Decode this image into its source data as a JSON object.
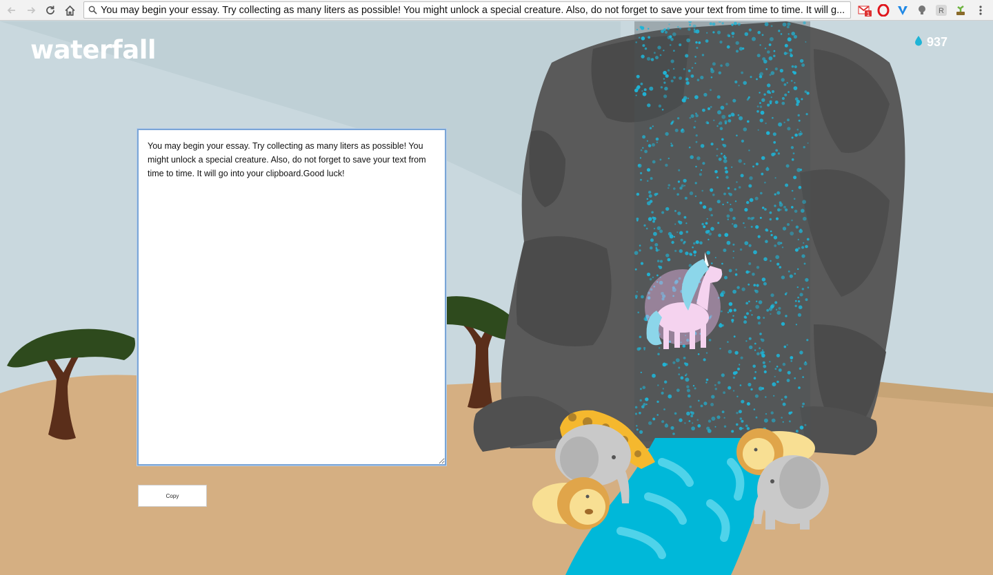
{
  "browser": {
    "address_text": "You may begin your essay. Try collecting as many liters as possible! You might unlock a special creature. Also, do not forget to save your text from time to time. It will g...",
    "extension_badge": "1"
  },
  "app": {
    "logo": "waterfall",
    "liters": "937"
  },
  "editor": {
    "text": "You may begin your essay. Try collecting as many liters as possible! You might unlock a special creature. Also, do not forget to save your text from time to time. It will go into your clipboard.Good luck!"
  },
  "copy_button": {
    "label": "Copy"
  },
  "colors": {
    "sky": "#c9d8de",
    "ground": "#d5af82",
    "rock": "#555555",
    "water": "#00b8d9",
    "accent": "#1fb4d6"
  },
  "icons": [
    "back-icon",
    "forward-icon",
    "reload-icon",
    "home-icon",
    "search-icon",
    "gmail-icon",
    "opera-icon",
    "extension-v-icon",
    "bulb-icon",
    "r-icon",
    "plant-icon",
    "menu-icon",
    "water-drop-icon"
  ]
}
